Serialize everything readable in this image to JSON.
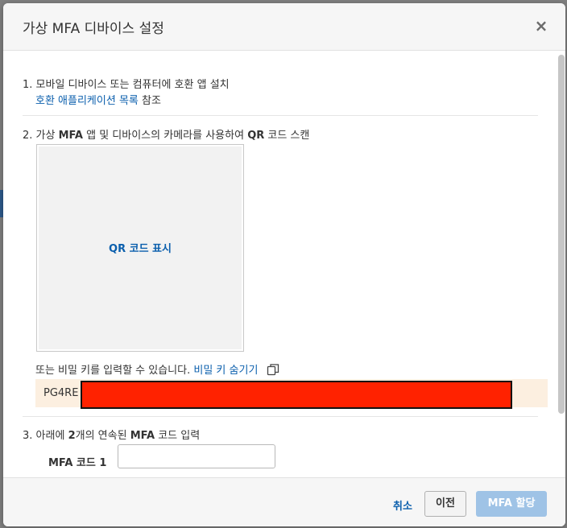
{
  "modal": {
    "title": "가상 MFA 디바이스 설정",
    "close_glyph": "×"
  },
  "step1": {
    "title": "1. 모바일 디바이스 또는 컴퓨터에 호환 앱 설치",
    "link": "호환 애플리케이션 목록",
    "suffix": " 참조"
  },
  "step2": {
    "prefix": "2. 가상 ",
    "mfa": "MFA",
    "middle": " 앱 및 디바이스의 카메라를 사용하여 ",
    "qr": "QR",
    "suffix": " 코드 스캔",
    "qr_show_label": "QR 코드 표시",
    "secret_prompt": "또는 비밀 키를 입력할 수 있습니다. ",
    "secret_toggle_link": "비밀 키 숨기기",
    "secret_key_visible": "PG4RE"
  },
  "step3": {
    "prefix": "3. 아래에 ",
    "count": "2",
    "middle": "개의 연속된 ",
    "mfa": "MFA",
    "suffix": " 코드 입력",
    "code1_label": "MFA 코드 1",
    "code1_value": ""
  },
  "footer": {
    "cancel_label": "취소",
    "prev_label": "이전",
    "assign_label": "MFA 할당"
  },
  "colors": {
    "link": "#0b5fad",
    "primary_button_disabled": "#9fc3e6",
    "secret_bg": "#fcefe0",
    "redaction": "#ff2200"
  },
  "icons": {
    "close": "close-icon",
    "copy": "copy-icon"
  }
}
